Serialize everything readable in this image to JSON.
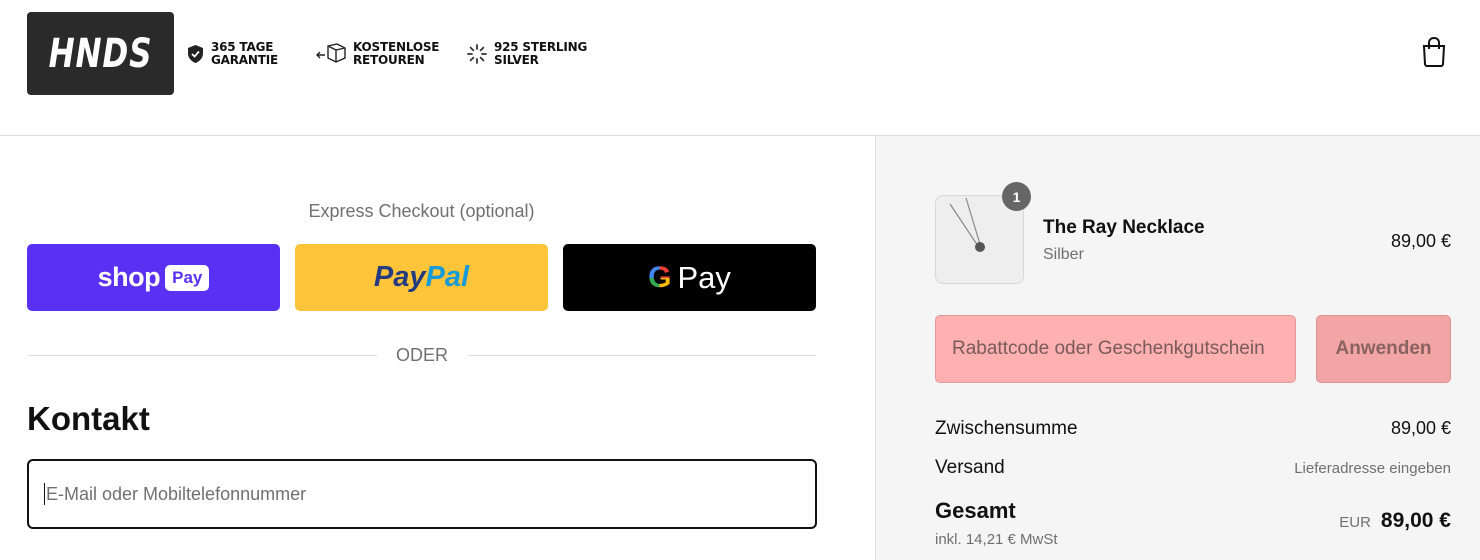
{
  "brand": {
    "logo_text": "HNDS"
  },
  "header": {
    "badges": [
      {
        "line1": "365 TAGE",
        "line2": "GARANTIE",
        "icon": "shield-check-icon"
      },
      {
        "line1": "KOSTENLOSE",
        "line2": "RETOUREN",
        "icon": "box-return-icon"
      },
      {
        "line1": "925 STERLING",
        "line2": "SILVER",
        "icon": "sparkle-icon"
      }
    ],
    "cart_icon": "shopping-bag-icon"
  },
  "express": {
    "label": "Express Checkout (optional)",
    "shop_pay": {
      "word": "shop",
      "tag": "Pay"
    },
    "paypal": {
      "part1": "Pay",
      "part2": "Pal"
    },
    "gpay": {
      "g": "G",
      "word": "Pay"
    },
    "divider_text": "ODER"
  },
  "contact": {
    "heading": "Kontakt",
    "email_placeholder": "E-Mail oder Mobiltelefonnummer"
  },
  "order": {
    "product": {
      "name": "The Ray Necklace",
      "variant": "Silber",
      "price": "89,00 €",
      "quantity": "1"
    },
    "discount": {
      "placeholder": "Rabattcode oder Geschenkgutschein",
      "apply_label": "Anwenden"
    },
    "subtotal_label": "Zwischensumme",
    "subtotal_value": "89,00 €",
    "shipping_label": "Versand",
    "shipping_value": "Lieferadresse eingeben",
    "total_label": "Gesamt",
    "tax_note": "inkl. 14,21 € MwSt",
    "currency": "EUR",
    "total_value": "89,00 €"
  },
  "colors": {
    "shop_pay": "#5a31f4",
    "paypal": "#ffc439",
    "gpay": "#000000",
    "coupon_bg": "#ffb0b0",
    "sidebar_bg": "#f5f5f5"
  }
}
